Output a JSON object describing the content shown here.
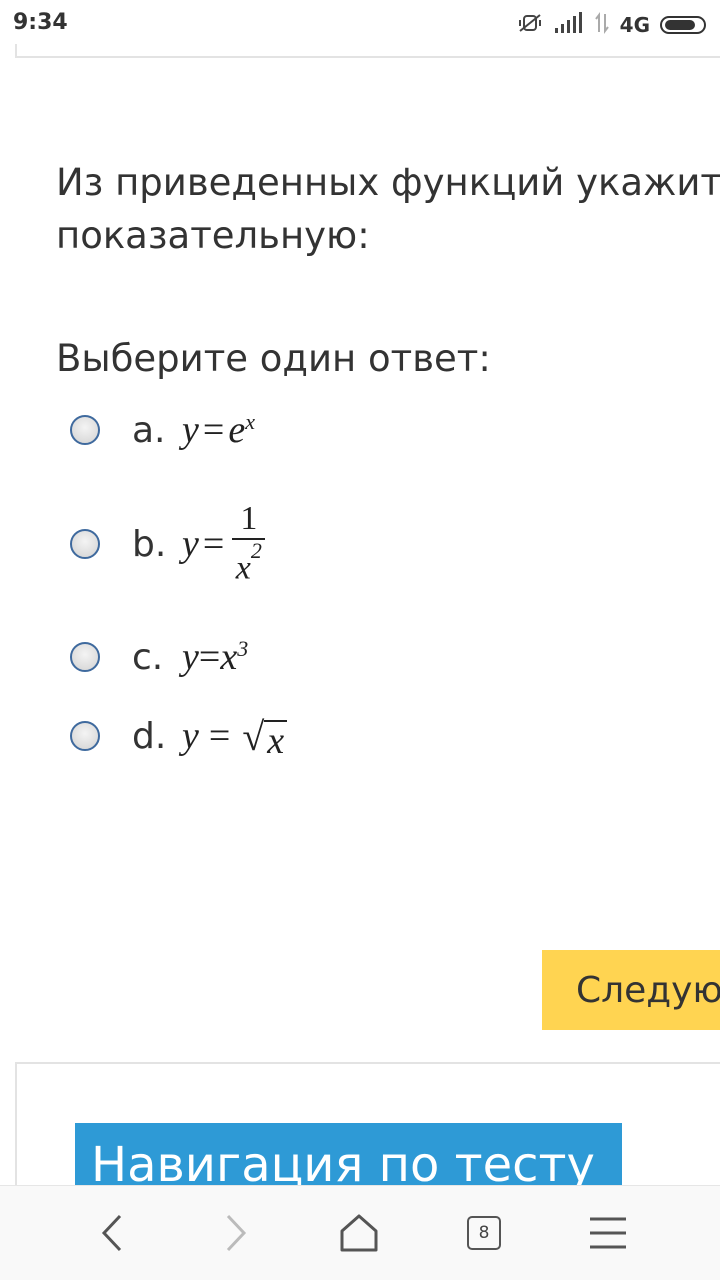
{
  "status_bar": {
    "time": "9:34",
    "network": "4G",
    "icons": [
      "mute-icon",
      "signal-icon",
      "data-arrows-icon",
      "battery-icon"
    ]
  },
  "question": {
    "text_line1": "Из приведенных функций укажите",
    "text_line2": "показательную:",
    "prompt": "Выберите один ответ:"
  },
  "answers": [
    {
      "letter": "a.",
      "formula": "y=e^x"
    },
    {
      "letter": "b.",
      "formula": "y=1/x^2"
    },
    {
      "letter": "c.",
      "formula": "y=x^3"
    },
    {
      "letter": "d.",
      "formula": "y=√x"
    }
  ],
  "math": {
    "y": "y",
    "eq": "=",
    "e": "e",
    "x": "x",
    "one": "1",
    "two": "2",
    "three": "3",
    "root": "√"
  },
  "next_button": {
    "label": "Следующая страница"
  },
  "navigation": {
    "header": "Навигация по тесту"
  },
  "toolbar": {
    "tab_count": "8",
    "icons": [
      "back-icon",
      "forward-icon",
      "home-icon",
      "tabs-icon",
      "menu-icon"
    ]
  },
  "colors": {
    "accent_yellow": "#ffd451",
    "nav_blue": "#2e9ad6",
    "radio_border": "#3f6a9e"
  }
}
